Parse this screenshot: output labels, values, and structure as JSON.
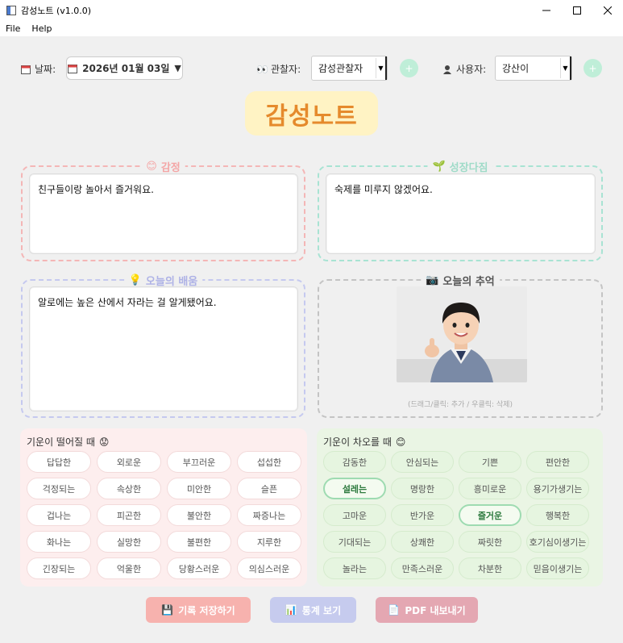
{
  "window": {
    "title": "감성노트 (v1.0.0)"
  },
  "menu": [
    "File",
    "Help"
  ],
  "toolbar": {
    "date_label": "날짜:",
    "date_value": "2026년 01월 03일",
    "observer_label": "관찰자:",
    "observer_value": "감성관찰자",
    "user_label": "사용자:",
    "user_value": "강산이",
    "add_symbol": "+"
  },
  "logo": "감성노트",
  "sections": {
    "emotion": {
      "title": "감정",
      "text": "친구들이랑 놀아서 즐거워요."
    },
    "growth": {
      "title": "성장다짐",
      "text": "숙제를 미루지 않겠어요."
    },
    "learning": {
      "title": "오늘의 배움",
      "text": "알로에는 높은 산에서 자라는 걸 알게됐어요."
    },
    "memory": {
      "title": "오늘의 추억",
      "hint": "(드래그/클릭: 추가 / 우클릭: 삭제)"
    }
  },
  "low_mood": {
    "title": "기운이 떨어질 때",
    "chips": [
      "답답한",
      "외로운",
      "부끄러운",
      "섭섭한",
      "걱정되는",
      "속상한",
      "미안한",
      "슬픈",
      "겁나는",
      "피곤한",
      "불안한",
      "짜증나는",
      "화나는",
      "실망한",
      "불편한",
      "지루한",
      "긴장되는",
      "억울한",
      "당황스러운",
      "의심스러운"
    ]
  },
  "high_mood": {
    "title": "기운이 차오를 때",
    "chips": [
      "감동한",
      "안심되는",
      "기쁜",
      "편안한",
      "설레는",
      "명랑한",
      "흥미로운",
      "용기가생기는",
      "고마운",
      "반가운",
      "즐거운",
      "행복한",
      "기대되는",
      "상쾌한",
      "짜릿한",
      "호기심이생기는",
      "놀라는",
      "만족스러운",
      "차분한",
      "믿음이생기는"
    ],
    "selected": [
      "설레는",
      "즐거운"
    ]
  },
  "actions": {
    "save": "기록 저장하기",
    "stats": "통계 보기",
    "pdf": "PDF 내보내기"
  },
  "colors": {
    "emotion_border": "#f4b6b6",
    "growth_border": "#a8e3d3",
    "learning_border": "#c5c9ef",
    "memory_border": "#c4c4c4",
    "save_btn": "#f7b2ae",
    "stats_btn": "#c6cbee",
    "pdf_btn": "#e4a7b2",
    "low_panel": "#fdeeee",
    "high_panel": "#eaf5e4"
  }
}
